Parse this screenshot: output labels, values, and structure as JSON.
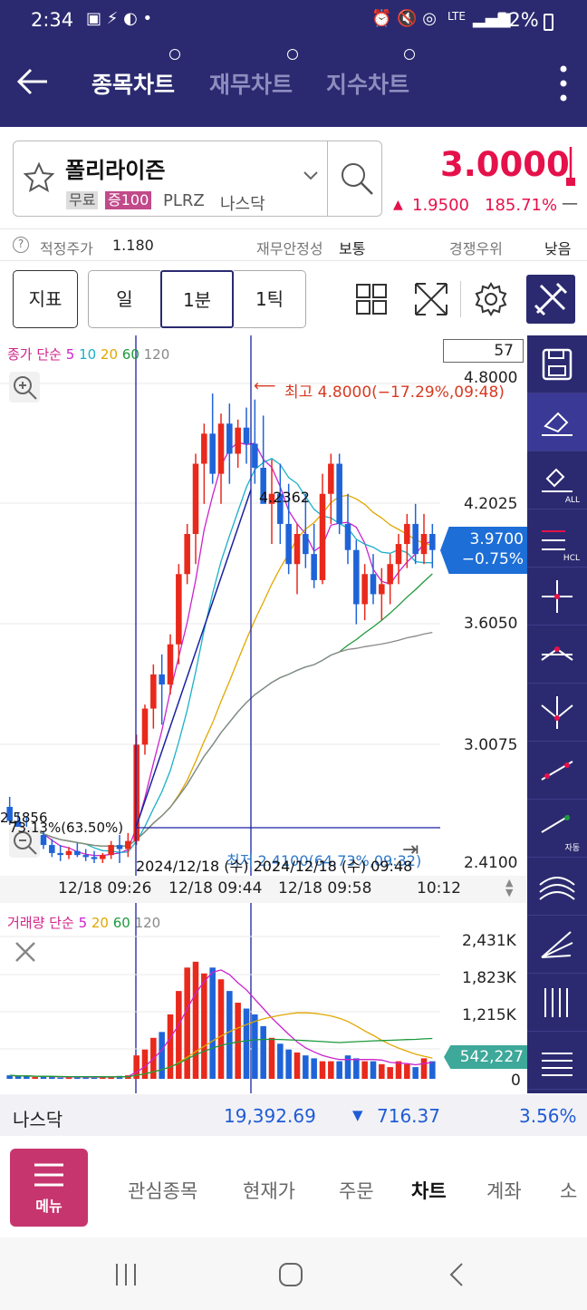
{
  "status": {
    "time": "2:34",
    "network": "LTE",
    "battery": "52%"
  },
  "header": {
    "tabs": [
      {
        "label": "종목차트",
        "active": true
      },
      {
        "label": "재무차트",
        "active": false
      },
      {
        "label": "지수차트",
        "active": false
      }
    ]
  },
  "stock": {
    "name": "폴리라이즌",
    "badge_free": "무료",
    "badge_margin": "증100",
    "ticker": "PLRZ",
    "exchange": "나스닥",
    "price": "3.0000",
    "change": "1.9500",
    "change_pct": "185.71%",
    "change_extra": "—"
  },
  "info": {
    "fair_price_label": "적정주가",
    "fair_price_value": "1.180",
    "fin_stability_label": "재무안정성",
    "fin_stability_value": "보통",
    "competition_label": "경쟁우위",
    "competition_value": "낮음"
  },
  "toolbar": {
    "indicator": "지표",
    "period_day": "일",
    "period_1min": "1분",
    "period_1tick": "1틱"
  },
  "price_chart": {
    "legend_prefix": "종가 단순",
    "ma_periods": [
      {
        "label": "5",
        "color": "#cc22cc"
      },
      {
        "label": "10",
        "color": "#1ab0c8"
      },
      {
        "label": "20",
        "color": "#e0a800"
      },
      {
        "label": "60",
        "color": "#1c9a3c"
      },
      {
        "label": "120",
        "color": "#888888"
      }
    ],
    "candle_count": "57",
    "high_annotation": "최고 4.8000(−17.29%,09:48)",
    "low_annotation": "최저 2.4100(64.73%,09:32)",
    "cursor_dates": "2024/12/18 (수) 2024/12/18 (수) 09:48",
    "value_4236": "4.2362",
    "value_2585": "2.5856",
    "value_pct": "73.13%(63.50%)",
    "y_ticks": [
      "4.8000",
      "4.2025",
      "3.6050",
      "3.0075",
      "2.4100"
    ],
    "current_price": "3.9700",
    "current_pct": "−0.75%",
    "x_ticks": [
      "12/18 09:26",
      "12/18 09:44",
      "12/18 09:58",
      "10:12"
    ]
  },
  "volume_chart": {
    "legend_prefix": "거래량 단순",
    "ma_periods": [
      {
        "label": "5",
        "color": "#cc22cc"
      },
      {
        "label": "20",
        "color": "#e0a800"
      },
      {
        "label": "60",
        "color": "#1c9a3c"
      },
      {
        "label": "120",
        "color": "#888888"
      }
    ],
    "y_ticks": [
      "2,431K",
      "1,823K",
      "1,215K",
      "0"
    ],
    "current_volume": "542,227"
  },
  "sidebar_tools": [
    {
      "icon": "save-icon"
    },
    {
      "icon": "eraser-icon"
    },
    {
      "icon": "eraser-all-icon",
      "label": "ALL"
    },
    {
      "icon": "hlc-line-icon",
      "label": "HCL"
    },
    {
      "icon": "cross-line-icon"
    },
    {
      "icon": "peak-line-icon"
    },
    {
      "icon": "valley-line-icon"
    },
    {
      "icon": "trend-line-icon"
    },
    {
      "icon": "auto-trend-icon",
      "label": "자동"
    },
    {
      "icon": "arc-icon"
    },
    {
      "icon": "fan-line-icon"
    },
    {
      "icon": "vertical-lines-icon"
    },
    {
      "icon": "horizontal-lines-icon"
    }
  ],
  "index_bar": {
    "name": "나스닥",
    "value": "19,392.69",
    "change": "716.37",
    "change_pct": "3.56%"
  },
  "bottom_nav": {
    "menu": "메뉴",
    "items": [
      "관심종목",
      "현재가",
      "주문",
      "차트",
      "계좌",
      "소"
    ],
    "active_index": 3
  },
  "colors": {
    "brand": "#2b2a70",
    "up": "#e5114a",
    "down": "#1f5cd6",
    "candle_up": "#e8291c",
    "candle_down": "#1f63d8"
  },
  "chart_data": {
    "type": "candlestick",
    "candles": [
      [
        2.69,
        2.74,
        2.6,
        2.62
      ],
      [
        2.62,
        2.66,
        2.55,
        2.59
      ],
      [
        2.59,
        2.64,
        2.5,
        2.52
      ],
      [
        2.52,
        2.58,
        2.47,
        2.55
      ],
      [
        2.55,
        2.57,
        2.48,
        2.5
      ],
      [
        2.5,
        2.53,
        2.44,
        2.46
      ],
      [
        2.46,
        2.5,
        2.42,
        2.45
      ],
      [
        2.45,
        2.49,
        2.43,
        2.47
      ],
      [
        2.47,
        2.51,
        2.44,
        2.45
      ],
      [
        2.45,
        2.48,
        2.42,
        2.44
      ],
      [
        2.44,
        2.47,
        2.41,
        2.43
      ],
      [
        2.43,
        2.46,
        2.41,
        2.45
      ],
      [
        2.45,
        2.52,
        2.43,
        2.5
      ],
      [
        2.5,
        2.55,
        2.41,
        2.48
      ],
      [
        2.48,
        2.56,
        2.44,
        2.52
      ],
      [
        2.52,
        3.05,
        2.5,
        3.0
      ],
      [
        3.0,
        3.2,
        2.95,
        3.18
      ],
      [
        3.18,
        3.4,
        3.08,
        3.35
      ],
      [
        3.35,
        3.45,
        3.1,
        3.3
      ],
      [
        3.3,
        3.55,
        3.25,
        3.5
      ],
      [
        3.5,
        3.9,
        3.4,
        3.85
      ],
      [
        3.85,
        4.1,
        3.8,
        4.05
      ],
      [
        4.05,
        4.45,
        3.9,
        4.4
      ],
      [
        4.4,
        4.6,
        4.2,
        4.55
      ],
      [
        4.55,
        4.75,
        4.3,
        4.35
      ],
      [
        4.35,
        4.65,
        4.2,
        4.6
      ],
      [
        4.6,
        4.7,
        4.3,
        4.45
      ],
      [
        4.45,
        4.62,
        4.38,
        4.58
      ],
      [
        4.58,
        4.68,
        4.4,
        4.5
      ],
      [
        4.5,
        4.72,
        4.3,
        4.38
      ],
      [
        4.38,
        4.64,
        4.28,
        4.2
      ],
      [
        4.2,
        4.42,
        4.0,
        4.25
      ],
      [
        4.25,
        4.4,
        4.0,
        4.1
      ],
      [
        4.1,
        4.3,
        3.85,
        3.9
      ],
      [
        3.9,
        4.1,
        3.75,
        4.05
      ],
      [
        4.05,
        4.25,
        3.88,
        3.95
      ],
      [
        3.95,
        4.1,
        3.78,
        3.82
      ],
      [
        3.82,
        4.35,
        3.8,
        4.25
      ],
      [
        4.25,
        4.45,
        4.1,
        4.4
      ],
      [
        4.4,
        4.45,
        4.05,
        4.1
      ],
      [
        4.1,
        4.25,
        3.9,
        3.97
      ],
      [
        3.97,
        4.02,
        3.6,
        3.7
      ],
      [
        3.7,
        3.9,
        3.62,
        3.85
      ],
      [
        3.85,
        3.95,
        3.7,
        3.75
      ],
      [
        3.75,
        3.88,
        3.62,
        3.8
      ],
      [
        3.8,
        3.95,
        3.7,
        3.9
      ],
      [
        3.9,
        4.05,
        3.8,
        4.0
      ],
      [
        4.0,
        4.15,
        3.88,
        4.1
      ],
      [
        4.1,
        4.2,
        3.9,
        3.95
      ],
      [
        3.95,
        4.15,
        3.9,
        4.05
      ],
      [
        4.05,
        4.1,
        3.88,
        3.97
      ]
    ],
    "volumes": [
      60,
      40,
      50,
      30,
      40,
      30,
      20,
      30,
      40,
      30,
      20,
      30,
      30,
      50,
      60,
      400,
      500,
      700,
      800,
      1100,
      1500,
      1900,
      2000,
      1800,
      1900,
      1700,
      1500,
      1300,
      1200,
      1100,
      900,
      700,
      600,
      500,
      450,
      400,
      350,
      300,
      300,
      300,
      400,
      350,
      300,
      300,
      250,
      200,
      300,
      250,
      200,
      350,
      300
    ],
    "y_range": [
      2.41,
      4.8
    ],
    "volume_range": [
      0,
      2431
    ]
  }
}
